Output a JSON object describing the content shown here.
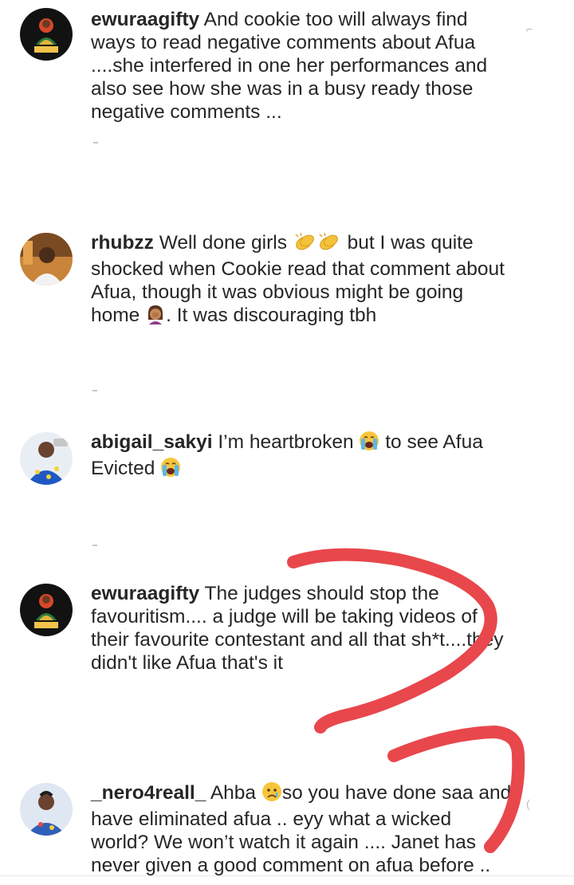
{
  "comments": [
    {
      "username": "ewuraagifty",
      "text": "And cookie too will always find ways to read negative comments about Afua ....she interfered in one her performances and also see how she was in a busy ready those negative comments ...",
      "avatar_label": "Afua"
    },
    {
      "username": "rhubzz",
      "text_before_clap": "Well done girls",
      "text_after_clap": "but I was quite shocked when Cookie read that comment about Afua, though it was obvious might be going home",
      "text_after_facepalm": ". It was discouraging tbh"
    },
    {
      "username": "abigail_sakyi",
      "text_before_cry": "I’m heartbroken",
      "text_middle": "to see Afua Evicted"
    },
    {
      "username": "ewuraagifty",
      "text": "The judges should stop the favouritism.... a judge will be taking videos of their favourite contestant and all that sh*t....they didn't like Afua that's it",
      "avatar_label": "Afua"
    },
    {
      "username": "_nero4reall_",
      "text_before_emoji": "Ahba",
      "text_after_emoji": "so you have done saa and have eliminated afua .. eyy what a wicked world? We won’t watch it again .... Janet has never given a good comment on afua before .."
    }
  ],
  "colors": {
    "text": "#262626",
    "scribble": "#e8474c",
    "muted": "#c7c7c7"
  },
  "icons": {
    "clap": "clapping-hands-emoji",
    "facepalm": "woman-facepalming-emoji",
    "cry": "loudly-crying-face-emoji",
    "sad": "crying-face-emoji"
  }
}
